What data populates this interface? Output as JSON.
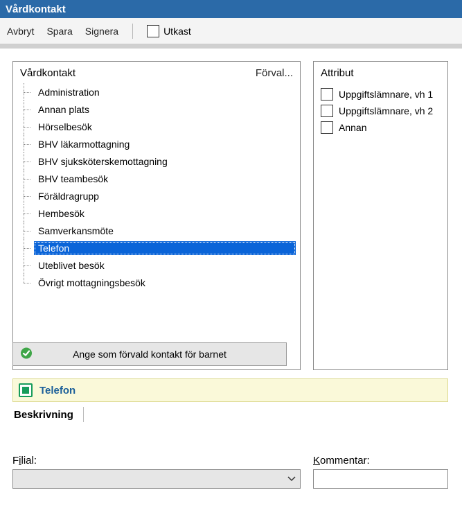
{
  "window": {
    "title": "Vårdkontakt"
  },
  "toolbar": {
    "cancel": "Avbryt",
    "save": "Spara",
    "sign": "Signera",
    "draft": "Utkast"
  },
  "leftPanel": {
    "title": "Vårdkontakt",
    "presetLink": "Förval...",
    "items": [
      "Administration",
      "Annan plats",
      "Hörselbesök",
      "BHV läkarmottagning",
      "BHV sjuksköterskemottagning",
      "BHV teambesök",
      "Föräldragrupp",
      "Hembesök",
      "Samverkansmöte",
      "Telefon",
      "Uteblivet besök",
      "Övrigt mottagningsbesök"
    ],
    "selectedIndex": 9,
    "defaultButton": "Ange som förvald kontakt för barnet"
  },
  "rightPanel": {
    "title": "Attribut",
    "items": [
      "Uppgiftslämnare, vh 1",
      "Uppgiftslämnare, vh 2",
      "Annan"
    ]
  },
  "selectedBar": {
    "label": "Telefon"
  },
  "description": {
    "label": "Beskrivning"
  },
  "fields": {
    "filial": {
      "label_pre": "F",
      "label_accel": "i",
      "label_post": "lial:"
    },
    "kommentar": {
      "label_pre": "",
      "label_accel": "K",
      "label_post": "ommentar:"
    }
  }
}
